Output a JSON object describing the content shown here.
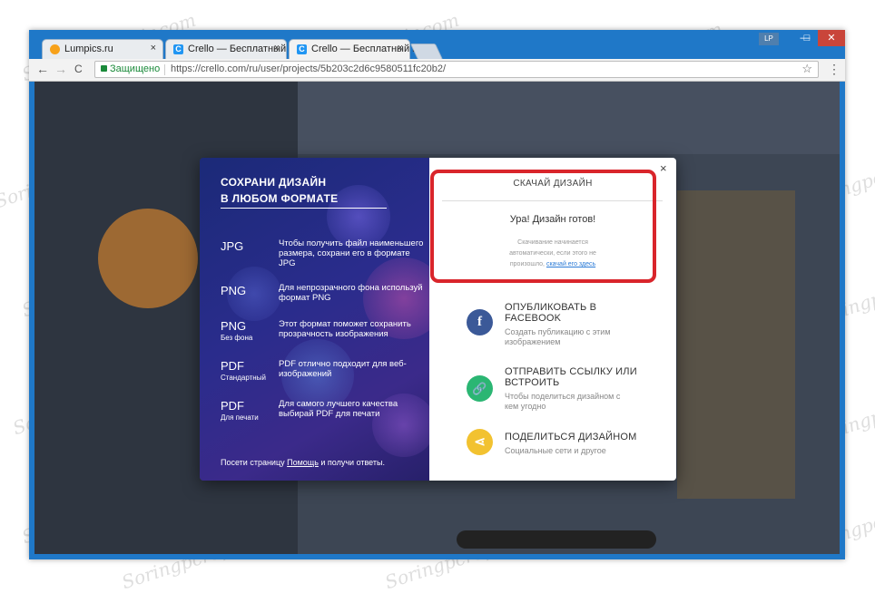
{
  "browser": {
    "profile_badge": "LP",
    "min_glyph": "—",
    "max_glyph": "□",
    "close_glyph": "✕",
    "tabs": [
      {
        "title": "Lumpics.ru",
        "close": "×"
      },
      {
        "title": "Crello — Бесплатный ин",
        "close": "×"
      },
      {
        "title": "Crello — Бесплатный ин",
        "close": "×"
      }
    ],
    "back": "←",
    "forward": "→",
    "reload": "C",
    "secure_label": "Защищено",
    "url": "https://crello.com/ru/user/projects/5b203c2d6c9580511fc20b2/",
    "star": "☆",
    "menu": "⋮"
  },
  "modal": {
    "left": {
      "heading_line1": "СОХРАНИ ДИЗАЙН",
      "heading_line2": "В ЛЮБОМ ФОРМАТЕ",
      "formats": [
        {
          "name": "JPG",
          "sub": "",
          "desc": "Чтобы получить файл наименьшего размера, сохрани его в формате JPG"
        },
        {
          "name": "PNG",
          "sub": "",
          "desc": "Для непрозрачного фона используй формат PNG"
        },
        {
          "name": "PNG",
          "sub": "Без фона",
          "desc": "Этот формат поможет сохранить прозрачность изображения"
        },
        {
          "name": "PDF",
          "sub": "Стандартный",
          "desc": "PDF отлично подходит для веб-изображений"
        },
        {
          "name": "PDF",
          "sub": "Для печати",
          "desc": "Для самого лучшего качества выбирай PDF для печати"
        }
      ],
      "footer_pre": "Посети страницу ",
      "footer_link": "Помощь",
      "footer_post": " и получи ответы."
    },
    "close": "×",
    "download": {
      "title": "СКАЧАЙ ДИЗАЙН",
      "ready": "Ура! Дизайн готов!",
      "note_line1": "Скачивание начинается",
      "note_line2": "автоматически, если этого не",
      "note_line3_pre": "произошло, ",
      "note_link": "скачай его здесь"
    },
    "actions": [
      {
        "icon": "f",
        "title_line1": "ОПУБЛИКОВАТЬ В",
        "title_line2": "FACEBOOK",
        "sub_line1": "Создать публикацию с этим",
        "sub_line2": "изображением",
        "color": "#3b5998"
      },
      {
        "icon": "🔗",
        "title_line1": "ОТПРАВИТЬ ССЫЛКУ ИЛИ",
        "title_line2": "ВСТРОИТЬ",
        "sub_line1": "Чтобы поделиться дизайном с",
        "sub_line2": "кем угодно",
        "color": "#2bb673"
      },
      {
        "icon": "⋖",
        "title_line1": "ПОДЕЛИТЬСЯ ДИЗАЙНОМ",
        "title_line2": "",
        "sub_line1": "Социальные сети и другое",
        "sub_line2": "",
        "color": "#f2c230"
      }
    ]
  },
  "watermark": "Soringpcrepair.com"
}
